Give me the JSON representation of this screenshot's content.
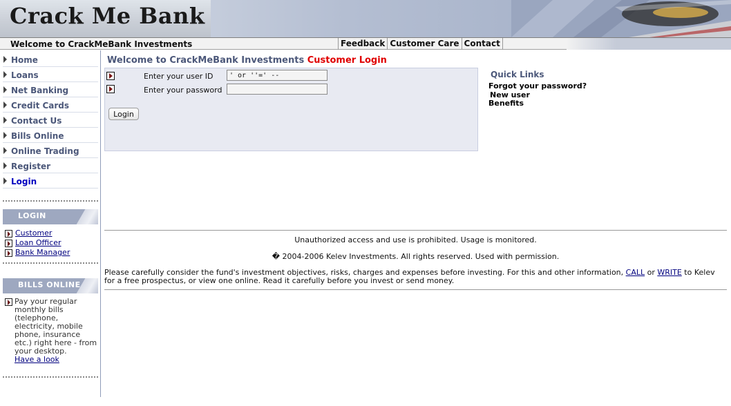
{
  "header": {
    "bank_name": "Crack Me Bank",
    "welcome": "Welcome to CrackMeBank Investments",
    "top_links": [
      "Feedback",
      "Customer Care",
      "Contact"
    ]
  },
  "sidebar": {
    "items": [
      {
        "label": "Home",
        "active": false
      },
      {
        "label": "Loans",
        "active": false
      },
      {
        "label": "Net Banking",
        "active": false
      },
      {
        "label": "Credit Cards",
        "active": false
      },
      {
        "label": "Contact Us",
        "active": false
      },
      {
        "label": "Bills Online",
        "active": false
      },
      {
        "label": "Online Trading",
        "active": false
      },
      {
        "label": "Register",
        "active": false
      },
      {
        "label": "Login",
        "active": true
      }
    ],
    "login_section": {
      "title": "LOGIN",
      "links": [
        "Customer",
        "Loan Officer",
        "Bank Manager"
      ]
    },
    "bills_section": {
      "title": "BILLS ONLINE",
      "text": "Pay your regular monthly bills (telephone, electricity, mobile phone, insurance etc.) right here - from your desktop.",
      "link": "Have a look"
    }
  },
  "main": {
    "title": "Welcome to CrackMeBank Investments",
    "title_highlight": "Customer Login",
    "form": {
      "user_label": "Enter your user ID",
      "user_value": "' or ''=' --",
      "password_label": "Enter your password",
      "password_value": "",
      "button_label": "Login"
    },
    "quick_links": {
      "title": "Quick Links",
      "links": [
        "Forgot your password?",
        "New user",
        "Benefits"
      ]
    }
  },
  "footer": {
    "unauthorized": "Unauthorized access and use is prohibited. Usage is monitored.",
    "copyright": "� 2004-2006 Kelev Investments. All rights reserved. Used with permission.",
    "disclaimer_part1": "Please carefully consider the fund's investment objectives, risks, charges and expenses before investing. For this and other information, ",
    "call_link": "CALL",
    "or_text": " or ",
    "write_link": "WRITE",
    "disclaimer_part2": " to Kelev for a free prospectus, or view one online. Read it carefully before you invest or send money."
  },
  "colors": {
    "nav_text": "#4c587a",
    "active_nav": "#0000c0",
    "highlight_red": "#e00000",
    "panel_bg": "#e8eaf2",
    "section_head_bg": "#9ea8c0",
    "link": "#00007f"
  }
}
